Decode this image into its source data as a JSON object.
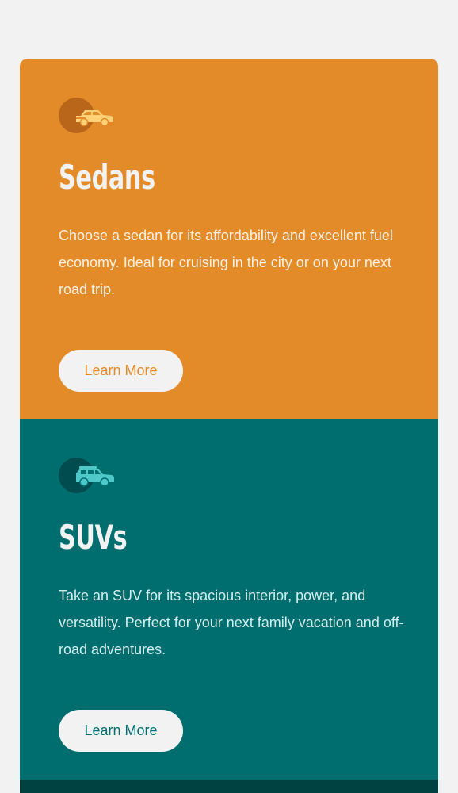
{
  "colors": {
    "page_background": "#f2f2f2",
    "sedan_accent": "#e38b29",
    "suv_accent": "#006e6f",
    "luxury_accent": "#004242",
    "light_text": "#f2f2f2"
  },
  "cards": [
    {
      "icon": "sedan-car-icon",
      "title": "Sedans",
      "description": "Choose a sedan for its affordability and excellent fuel economy. Ideal for cruising in the city or on your next road trip.",
      "button_label": "Learn More"
    },
    {
      "icon": "suv-car-icon",
      "title": "SUVs",
      "description": "Take an SUV for its spacious interior, power, and versatility. Perfect for your next family vacation and off-road adventures.",
      "button_label": "Learn More"
    }
  ]
}
